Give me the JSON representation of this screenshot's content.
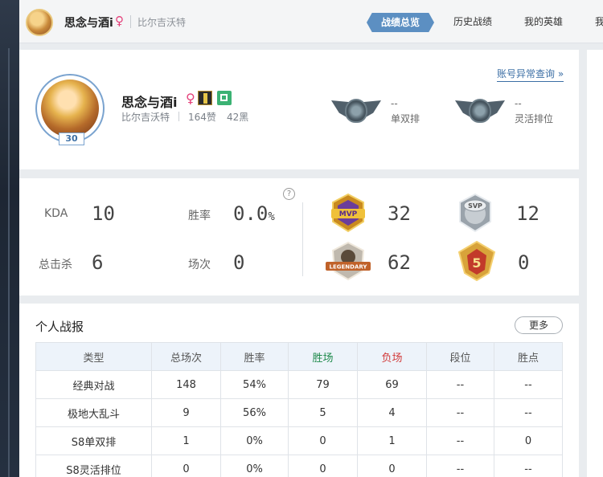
{
  "header": {
    "name": "思念与酒i",
    "gender": "♀",
    "server": "比尔吉沃特",
    "tabs": [
      "战绩总览",
      "历史战绩",
      "我的英雄",
      "我"
    ]
  },
  "profile": {
    "name": "思念与酒i",
    "gender": "♀",
    "level": "30",
    "server": "比尔吉沃特",
    "likes": "164赞",
    "blacks": "42黑",
    "abnormal_link": "账号异常查询 »",
    "ranks": [
      {
        "value": "--",
        "label": "单双排"
      },
      {
        "value": "--",
        "label": "灵活排位"
      }
    ]
  },
  "stats": {
    "kda_label": "KDA",
    "kda": "10",
    "winrate_label": "胜率",
    "winrate": "0.0",
    "winrate_unit": "%",
    "kills_label": "总击杀",
    "kills": "6",
    "games_label": "场次",
    "games": "0",
    "help": "?",
    "medals": {
      "mvp_text": "MVP",
      "mvp": "32",
      "svp_text": "SVP",
      "svp": "12",
      "legendary_text": "LEGENDARY",
      "legendary": "62",
      "five_text": "5",
      "five": "0"
    }
  },
  "report": {
    "title": "个人战报",
    "more": "更多",
    "columns": [
      "类型",
      "总场次",
      "胜率",
      "胜场",
      "负场",
      "段位",
      "胜点"
    ],
    "rows": [
      [
        "经典对战",
        "148",
        "54%",
        "79",
        "69",
        "--",
        "--"
      ],
      [
        "极地大乱斗",
        "9",
        "56%",
        "5",
        "4",
        "--",
        "--"
      ],
      [
        "S8单双排",
        "1",
        "0%",
        "0",
        "1",
        "--",
        "0"
      ],
      [
        "S8灵活排位",
        "0",
        "0%",
        "0",
        "0",
        "--",
        "--"
      ]
    ]
  }
}
